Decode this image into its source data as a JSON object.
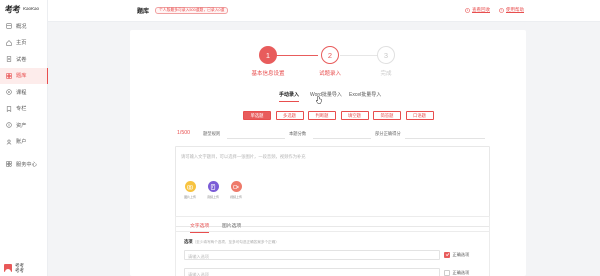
{
  "brand": {
    "zh": "考考",
    "en": "KaoKao"
  },
  "sidebar": {
    "items": [
      {
        "label": "概况",
        "icon": "overview-icon"
      },
      {
        "label": "主页",
        "icon": "home-icon"
      },
      {
        "label": "试卷",
        "icon": "paper-icon"
      },
      {
        "label": "题库",
        "icon": "question-bank-icon"
      },
      {
        "label": "课程",
        "icon": "course-icon"
      },
      {
        "label": "专栏",
        "icon": "column-icon"
      },
      {
        "label": "资产",
        "icon": "assets-icon"
      },
      {
        "label": "账户",
        "icon": "account-icon"
      },
      {
        "label": "服务中心",
        "icon": "service-icon"
      }
    ]
  },
  "user": {
    "name": "考考",
    "sub": "考考"
  },
  "header": {
    "title": "题库",
    "notice": "个人版最多可录入500道题，已录入0道",
    "link_view": "查看回收",
    "link_guide": "使用帮助"
  },
  "steps": [
    {
      "number": "1",
      "label": "基本信息设置"
    },
    {
      "number": "2",
      "label": "试题录入"
    },
    {
      "number": "3",
      "label": "完成"
    }
  ],
  "tabs": [
    "手动录入",
    "Word批量导入",
    "Excel批量导入"
  ],
  "question_types": [
    "单选题",
    "多选题",
    "判断题",
    "填空题",
    "简答题",
    "口语题"
  ],
  "score_row": {
    "count": "1/500",
    "label_a": "题型规则",
    "label_b": "本题分数",
    "label_c": "部分正确得分"
  },
  "editor": {
    "placeholder": "请可输入文字题目，可以选择一张图片，一段音频，视频作为补充",
    "uploads": [
      "图片上传",
      "音频上传",
      "视频上传"
    ]
  },
  "options": {
    "tabs": [
      "文字选项",
      "图片选项"
    ],
    "note": "选项",
    "note_hint": "（至少填写两个选项，至多可勾选正确答案多个正确）",
    "rows": [
      {
        "placeholder": "请输入选项",
        "check_label": "正确选项",
        "checked": true
      },
      {
        "placeholder": "请输入选项",
        "check_label": "正确选项",
        "checked": false
      }
    ]
  },
  "colors": {
    "accent": "#e84e4e"
  }
}
